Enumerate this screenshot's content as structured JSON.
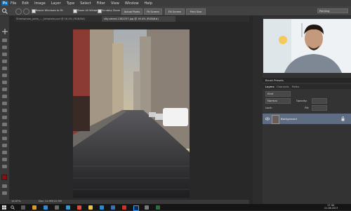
{
  "app": {
    "logo": "Ps"
  },
  "menu": [
    "File",
    "Edit",
    "Image",
    "Layer",
    "Type",
    "Select",
    "Filter",
    "View",
    "Window",
    "Help"
  ],
  "options_bar": {
    "resize_windows_label": "Resize Windows to Fit",
    "zoom_all_label": "Zoom All Windows",
    "scrubby_zoom_label": "Scrubby Zoom",
    "buttons": [
      "Actual Pixels",
      "Fit Screen",
      "Fill Screen",
      "Print Size"
    ],
    "workspace": "Painting"
  },
  "tabs": [
    "Streetphoto_paris_..._template.psd @ 16.4% (RGB/8#)",
    "city-street-1382257.jpg @ 16.4% (RGB/8#)"
  ],
  "status": {
    "zoom": "16.67%",
    "doc": "Doc: 22.9M/22.9M"
  },
  "layers_panel": {
    "title": "Brush Presets",
    "tabs": [
      "Layers",
      "Channels",
      "Paths"
    ],
    "kind": "Kind",
    "blend": "Normal",
    "opacity_label": "Opacity:",
    "lock_label": "Lock:",
    "fill_label": "Fill:",
    "layer_name": "Background"
  },
  "taskbar": {
    "time": "17:30",
    "date": "21.08.2017"
  },
  "icons": [
    "move-tool-icon",
    "zoom-tool-icon",
    "windows-start-icon",
    "search-icon",
    "eye-icon",
    "lock-icon"
  ],
  "colors": {
    "accent": "#0a6bb5",
    "panel": "#333333",
    "canvas": "#282828"
  }
}
